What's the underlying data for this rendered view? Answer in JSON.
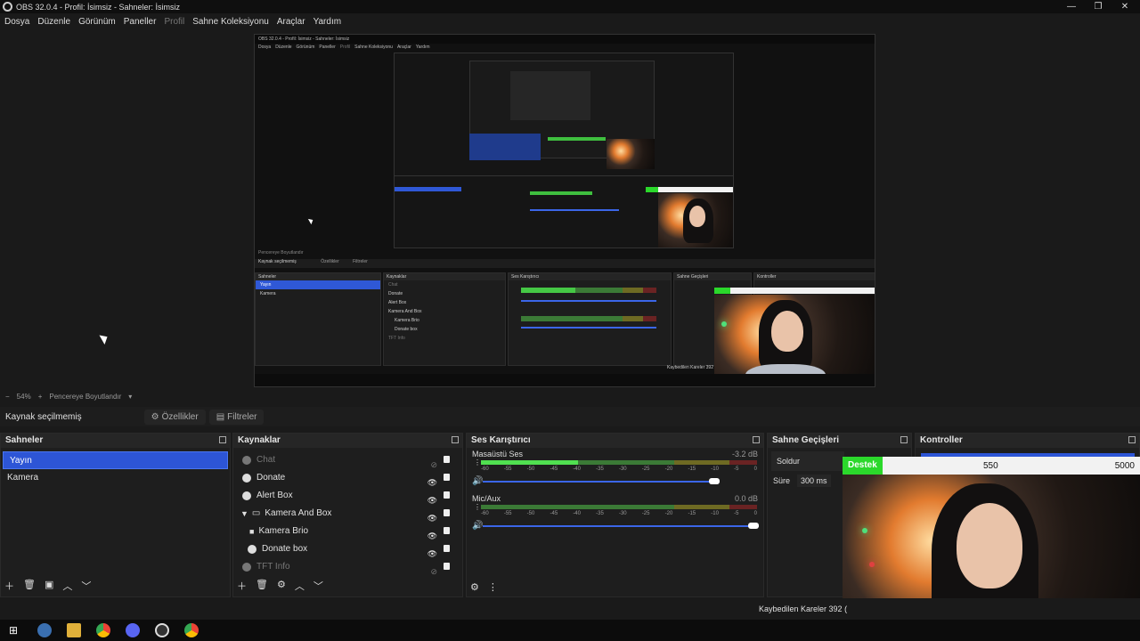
{
  "window": {
    "title": "OBS 32.0.4 - Profil: İsimsiz - Sahneler: İsimsiz"
  },
  "menu": [
    "Dosya",
    "Düzenle",
    "Görünüm",
    "Paneller",
    "Profil",
    "Sahne Koleksiyonu",
    "Araçlar",
    "Yardım"
  ],
  "nested": {
    "title": "OBS 32.0.4 - Profil: İsimsiz - Sahneler: İsimsiz",
    "menu": [
      "Dosya",
      "Düzenle",
      "Görünüm",
      "Paneller",
      "Profil",
      "Sahne Koleksiyonu",
      "Araçlar",
      "Yardım"
    ],
    "source_label": "Kaynak seçilmemiş",
    "props": "Özellikler",
    "filters": "Filtreler",
    "zoom": "Pencereye Boyutlandır",
    "scenes_header": "Sahneler",
    "sources_header": "Kaynaklar",
    "mixer_header": "Ses Karıştırıcı",
    "trans_header": "Sahne Geçişleri",
    "controls_header": "Kontroller",
    "scenes": [
      "Yayın",
      "Kamera"
    ],
    "sources": [
      "Chat",
      "Donate",
      "Alert Box",
      "Kamera And Box",
      "Kamera Brio",
      "Donate box",
      "TFT Info"
    ],
    "dropped": "Kaybedilen Kareler 392"
  },
  "zoom_bar": {
    "minus": "−",
    "zoom": "54%",
    "plus": "+",
    "fit": "Pencereye Boyutlandır"
  },
  "source_bar": {
    "label": "Kaynak seçilmemiş",
    "properties": "Özellikler",
    "filters": "Filtreler"
  },
  "scenes": {
    "header": "Sahneler",
    "items": [
      "Yayın",
      "Kamera"
    ]
  },
  "sources": {
    "header": "Kaynaklar",
    "items": [
      {
        "name": "Chat",
        "dim": true
      },
      {
        "name": "Donate",
        "dim": false
      },
      {
        "name": "Alert Box",
        "dim": false
      },
      {
        "name": "Kamera And Box",
        "dim": false
      },
      {
        "name": "Kamera Brio",
        "dim": false
      },
      {
        "name": "Donate box",
        "dim": false
      },
      {
        "name": "TFT Info",
        "dim": true
      }
    ]
  },
  "mixer": {
    "header": "Ses Karıştırıcı",
    "tracks": [
      {
        "name": "Masaüstü Ses",
        "db": "-3.2 dB",
        "level": 0.35
      },
      {
        "name": "Mic/Aux",
        "db": "0.0 dB",
        "level": 0
      }
    ],
    "ticks": [
      "-60",
      "-55",
      "-50",
      "-45",
      "-40",
      "-35",
      "-30",
      "-25",
      "-20",
      "-15",
      "-10",
      "-5",
      "0"
    ]
  },
  "transitions": {
    "header": "Sahne Geçişleri",
    "type": "Soldur",
    "duration_label": "Süre",
    "duration": "300 ms"
  },
  "controls": {
    "header": "Kontroller"
  },
  "overlay": {
    "label": "Destek",
    "current": "550",
    "goal": "5000"
  },
  "status": {
    "dropped": "Kaybedilen Kareler 392 ("
  }
}
